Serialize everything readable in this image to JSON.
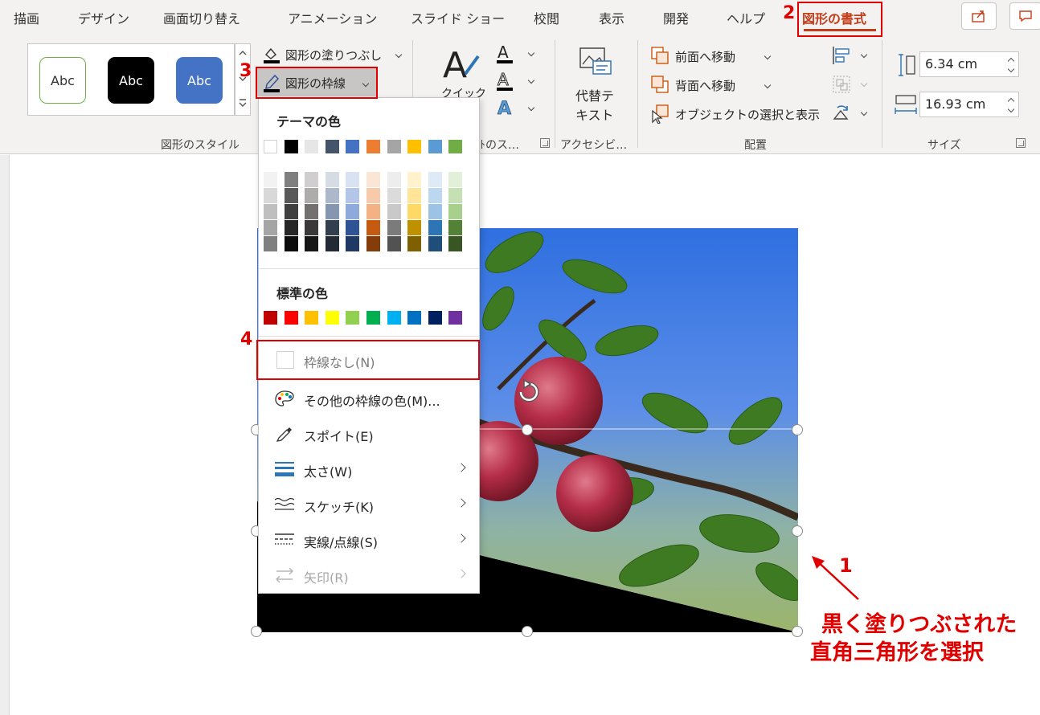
{
  "tabs": [
    {
      "label": "描画",
      "active": false
    },
    {
      "label": "デザイン",
      "active": false
    },
    {
      "label": "画面切り替え",
      "active": false
    },
    {
      "label": "アニメーション",
      "active": false
    },
    {
      "label": "スライド ショー",
      "active": false
    },
    {
      "label": "校閲",
      "active": false
    },
    {
      "label": "表示",
      "active": false
    },
    {
      "label": "開発",
      "active": false
    },
    {
      "label": "ヘルプ",
      "active": false
    },
    {
      "label": "図形の書式",
      "active": true
    }
  ],
  "ribbon": {
    "shape_styles": {
      "samples": [
        "Abc",
        "Abc",
        "Abc"
      ],
      "group_label": "図形のスタイル"
    },
    "shape_fill_label": "図形の塗りつぶし",
    "shape_outline_label": "図形の枠線",
    "wordart": {
      "quick_label": "クイック",
      "group_label": "ﾄのス…"
    },
    "accessibility": {
      "alt_text_line1": "代替テ",
      "alt_text_line2": "キスト",
      "group_label": "アクセシビ…"
    },
    "arrange": {
      "bring_forward": "前面へ移動",
      "send_backward": "背面へ移動",
      "selection_pane": "オブジェクトの選択と表示",
      "group_label": "配置"
    },
    "size": {
      "height": "6.34 cm",
      "width": "16.93 cm",
      "group_label": "サイズ"
    }
  },
  "menu": {
    "theme_colors_title": "テーマの色",
    "theme_colors": [
      "#ffffff",
      "#000000",
      "#e7e6e6",
      "#44546a",
      "#4472c4",
      "#ed7d31",
      "#a5a5a5",
      "#ffc000",
      "#5b9bd5",
      "#70ad47"
    ],
    "theme_shades": [
      [
        "#f2f2f2",
        "#7f7f7f",
        "#d0cece",
        "#d6dce4",
        "#d9e2f3",
        "#fbe5d5",
        "#ededed",
        "#fff2cc",
        "#deebf6",
        "#e2efd9"
      ],
      [
        "#d8d8d8",
        "#595959",
        "#aeabab",
        "#adb9ca",
        "#b4c6e7",
        "#f7caac",
        "#dbdbdb",
        "#fee599",
        "#bdd7ee",
        "#c5e0b3"
      ],
      [
        "#bfbfbf",
        "#3f3f3f",
        "#757070",
        "#8496b0",
        "#8eaadb",
        "#f4b183",
        "#c9c9c9",
        "#ffd965",
        "#9cc3e5",
        "#a8d08d"
      ],
      [
        "#a5a5a5",
        "#262626",
        "#3a3838",
        "#323f4f",
        "#2f5496",
        "#c55a11",
        "#7b7b7b",
        "#bf9000",
        "#2e75b5",
        "#538135"
      ],
      [
        "#7f7f7f",
        "#0c0c0c",
        "#171616",
        "#222a35",
        "#1f3864",
        "#843c0b",
        "#525252",
        "#7f6000",
        "#1e4e79",
        "#375623"
      ]
    ],
    "standard_colors_title": "標準の色",
    "standard_colors": [
      "#c00000",
      "#ff0000",
      "#ffc000",
      "#ffff00",
      "#92d050",
      "#00b050",
      "#00b0f0",
      "#0070c0",
      "#002060",
      "#7030a0"
    ],
    "items": {
      "no_outline": "枠線なし(N)",
      "more_colors": "その他の枠線の色(M)...",
      "eyedropper": "スポイト(E)",
      "weight": "太さ(W)",
      "sketch": "スケッチ(K)",
      "dashes": "実線/点線(S)",
      "arrows": "矢印(R)"
    }
  },
  "annotations": {
    "step1": "1",
    "step2": "2",
    "step3": "3",
    "step4": "4",
    "note_line1": "黒く塗りつぶされた",
    "note_line2": "直角三角形を選択",
    "accent_color": "#e00000"
  }
}
